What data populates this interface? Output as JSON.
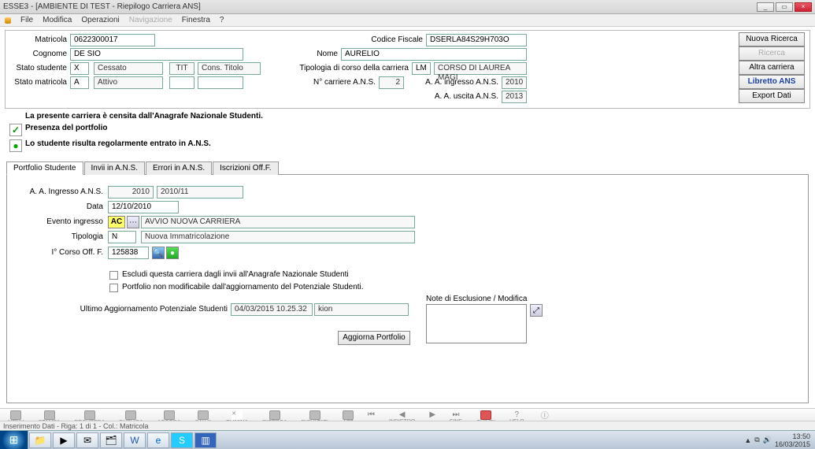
{
  "window": {
    "title": "ESSE3 - [AMBIENTE DI TEST - Riepilogo Carriera ANS]"
  },
  "menu": {
    "file": "File",
    "modifica": "Modifica",
    "operazioni": "Operazioni",
    "navigazione": "Navigazione",
    "finestra": "Finestra",
    "help": "?"
  },
  "top": {
    "matricola_lbl": "Matricola",
    "matricola": "0622300017",
    "cognome_lbl": "Cognome",
    "cognome": "DE SIO",
    "stato_studente_lbl": "Stato studente",
    "stato_studente_code": "X",
    "stato_studente_desc": "Cessato",
    "tit": "TIT",
    "cons_titolo": "Cons. Titolo",
    "stato_matricola_lbl": "Stato matricola",
    "stato_matricola_code": "A",
    "stato_matricola_desc": "Attivo",
    "cf_lbl": "Codice Fiscale",
    "cf": "DSERLA84S29H703O",
    "nome_lbl": "Nome",
    "nome": "AURELIO",
    "tipologia_lbl": "Tipologia di corso della carriera",
    "tipologia_code": "LM",
    "tipologia_desc": "CORSO DI LAUREA MAGI",
    "ncarr_lbl": "N° carriere A.N.S.",
    "ncarr": "2",
    "aa_in_lbl": "A. A. ingresso A.N.S.",
    "aa_in": "2010",
    "aa_out_lbl": "A. A. uscita A.N.S.",
    "aa_out": "2013"
  },
  "buttons": {
    "nuova": "Nuova Ricerca",
    "ricerca": "Ricerca",
    "altra": "Altra carriera",
    "libretto": "Libretto ANS",
    "export": "Export Dati",
    "aggiorna": "Aggiorna Portfolio"
  },
  "status": {
    "censita": "La presente carriera è censita dall'Anagrafe Nazionale Studenti.",
    "portfolio": "Presenza del portfolio",
    "regolare": "Lo studente risulta regolarmente entrato in A.N.S."
  },
  "tabs": {
    "t1": "Portfolio Studente",
    "t2": "Invii in A.N.S.",
    "t3": "Errori in A.N.S.",
    "t4": "Iscrizioni Off.F."
  },
  "pf": {
    "aa_lbl": "A. A. Ingresso A.N.S.",
    "aa_year": "2010",
    "aa_range": "2010/11",
    "data_lbl": "Data",
    "data": "12/10/2010",
    "evento_lbl": "Evento ingresso",
    "evento_code": "AC",
    "evento_desc": "AVVIO NUOVA CARRIERA",
    "tipologia_lbl": "Tipologia",
    "tipologia_code": "N",
    "tipologia_desc": "Nuova Immatricolazione",
    "corso_lbl": "I° Corso Off. F.",
    "corso": "125838",
    "chk1": "Escludi questa carriera dagli invii all'Anagrafe Nazionale Studenti",
    "chk2": "Portfolio non modificabile dall'aggiornamento del  Potenziale Studenti.",
    "ultimo_lbl": "Ultimo Aggiornamento Potenziale Studenti",
    "ultimo_data": "04/03/2015 10.25.32",
    "ultimo_user": "kion",
    "note_lbl": "Note di Esclusione / Modifica"
  },
  "toolbar": {
    "menu": "MENU",
    "stampa": "STAMPA",
    "recupera": "RECUPERA",
    "duplica": "DUPLICA",
    "accoda": "ACCODA",
    "salva": "SALVA",
    "elimina": "ELIMINA",
    "ricerca": "RICERCA",
    "risultati": "RISULTATI",
    "help": "HELP",
    "info": "INFO",
    "indietro": "INDIETRO",
    "fine": "FINE",
    "chiudi": "CHIUDI",
    "azz": "AZZ"
  },
  "statusbar": "Inserimento Dati - Riga: 1 di 1 - Col.: Matricola",
  "tray": {
    "time": "13:50",
    "date": "16/03/2015"
  }
}
